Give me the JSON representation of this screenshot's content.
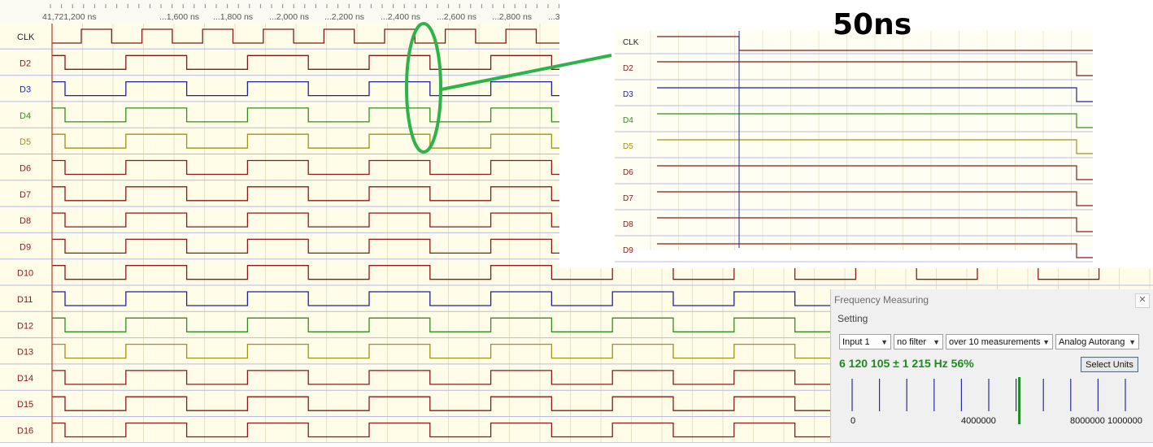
{
  "timeline": {
    "ticks": [
      "41,721,200 ns",
      "...1,600 ns",
      "...1,800 ns",
      "...2,000 ns",
      "...2,200 ns",
      "...2,400 ns",
      "...2,600 ns",
      "...2,800 ns",
      "...3"
    ]
  },
  "channels": [
    {
      "label": "CLK",
      "color": "#7f1a1a",
      "start": 1
    },
    {
      "label": "D2",
      "color": "#7f1a1a",
      "start": 1
    },
    {
      "label": "D3",
      "color": "#1f1fa8",
      "start": 1
    },
    {
      "label": "D4",
      "color": "#2f8f1f",
      "start": 1
    },
    {
      "label": "D5",
      "color": "#a39018",
      "start": 1
    },
    {
      "label": "D6",
      "color": "#8a1a1a",
      "start": 1
    },
    {
      "label": "D7",
      "color": "#8a1a1a",
      "start": 1
    },
    {
      "label": "D8",
      "color": "#8a1a1a",
      "start": 1
    },
    {
      "label": "D9",
      "color": "#8a1a1a",
      "start": 1
    },
    {
      "label": "D10",
      "color": "#8a1a1a",
      "start": 1
    },
    {
      "label": "D11",
      "color": "#1f1fa8",
      "start": 1
    },
    {
      "label": "D12",
      "color": "#2f8f1f",
      "start": 1
    },
    {
      "label": "D13",
      "color": "#a39018",
      "start": 1
    },
    {
      "label": "D14",
      "color": "#8a1a1a",
      "start": 1
    },
    {
      "label": "D15",
      "color": "#8a1a1a",
      "start": 1
    },
    {
      "label": "D16",
      "color": "#8a1a1a",
      "start": 1
    }
  ],
  "label_colors": {
    "CLK": "#222222",
    "D2": "#8a1a1a",
    "D3": "#1f1fa8",
    "D4": "#2f8f1f",
    "D5": "#a39018"
  },
  "zoom": {
    "title": "50ns",
    "channels": [
      "CLK",
      "D2",
      "D3",
      "D4",
      "D5",
      "D6",
      "D7",
      "D8",
      "D9"
    ]
  },
  "annotation": {
    "ellipse_color": "#2db34a"
  },
  "frequency_panel": {
    "title": "Frequency Measuring",
    "close_icon": "close-icon",
    "setting_label": "Setting",
    "input_select": "Input 1",
    "filter_select": "no filter",
    "measurements_select": "over 10 measurements",
    "range_select": "Analog Autorang",
    "readout": "6 120 105 ±  1 215 Hz 56%",
    "select_units_label": "Select Units",
    "scale_labels": [
      "0",
      "4000000",
      "8000000",
      "1000000"
    ],
    "marker_value": 6120105
  },
  "colors": {
    "background": "#fffde8",
    "grid": "#e6e1c4",
    "row_divider": "#b8b9e8",
    "cursor": "#c0392b",
    "zoom_cursor": "#1a2aa8"
  }
}
